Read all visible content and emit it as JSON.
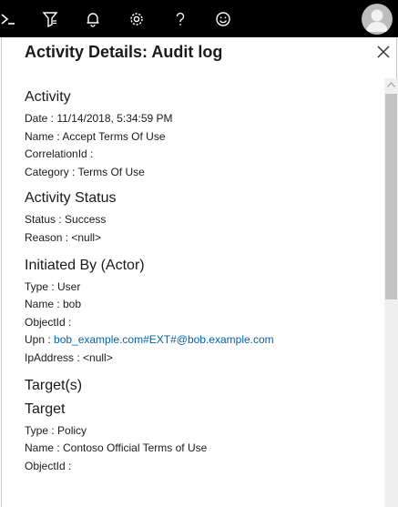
{
  "topbar": {
    "icons": [
      "cloud-shell-icon",
      "directory-filter-icon",
      "notifications-icon",
      "settings-icon",
      "help-icon",
      "feedback-icon"
    ],
    "avatar_icon": "user-avatar"
  },
  "panel": {
    "title": "Activity Details: Audit log",
    "close_icon": "close-icon"
  },
  "activity": {
    "heading": "Activity",
    "date": "Date : 11/14/2018, 5:34:59 PM",
    "name": "Name : Accept Terms Of Use",
    "correlation": "CorrelationId :",
    "category": "Category : Terms Of Use"
  },
  "status": {
    "heading": "Activity Status",
    "status": "Status : Success",
    "reason": "Reason : <null>"
  },
  "actor": {
    "heading": "Initiated By (Actor)",
    "type": "Type : User",
    "name": "Name : bob",
    "object_id": "ObjectId :",
    "upn_label": "Upn : ",
    "upn_value": "bob_example.com#EXT#@bob.example.com",
    "ip": "IpAddress : <null>"
  },
  "targets": {
    "heading": "Target(s)",
    "target_heading": "Target",
    "type": "Type : Policy",
    "name": "Name : Contoso Official Terms of Use",
    "object_id": "ObjectId :"
  },
  "colors": {
    "topbar": "#000000",
    "link": "#0063b1",
    "scrollbar_thumb": "#c2c2c2"
  }
}
